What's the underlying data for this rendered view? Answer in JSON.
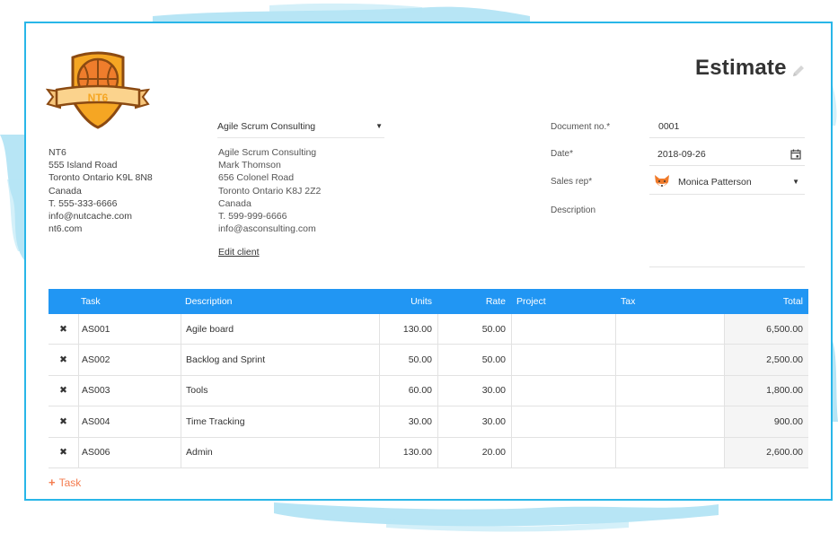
{
  "company": {
    "badge_text": "NT6",
    "lines": [
      "NT6",
      "555 Island Road",
      "Toronto Ontario K9L 8N8",
      "Canada",
      "T. 555-333-6666",
      "info@nutcache.com",
      "nt6.com"
    ]
  },
  "client": {
    "selected": "Agile Scrum Consulting",
    "lines": [
      "Agile Scrum Consulting",
      "Mark Thomson",
      "656 Colonel Road",
      "Toronto Ontario K8J 2Z2",
      "Canada",
      "T. 599-999-6666",
      "info@asconsulting.com"
    ],
    "edit_label": "Edit client"
  },
  "document": {
    "title": "Estimate",
    "doc_no_label": "Document no.*",
    "doc_no": "0001",
    "date_label": "Date*",
    "date": "2018-09-26",
    "sales_rep_label": "Sales rep*",
    "sales_rep": "Monica Patterson",
    "description_label": "Description",
    "description": ""
  },
  "table": {
    "headers": {
      "task": "Task",
      "description": "Description",
      "units": "Units",
      "rate": "Rate",
      "project": "Project",
      "tax": "Tax",
      "total": "Total"
    },
    "rows": [
      {
        "task": "AS001",
        "description": "Agile board",
        "units": "130.00",
        "rate": "50.00",
        "project": "",
        "tax": "",
        "total": "6,500.00"
      },
      {
        "task": "AS002",
        "description": "Backlog and Sprint",
        "units": "50.00",
        "rate": "50.00",
        "project": "",
        "tax": "",
        "total": "2,500.00"
      },
      {
        "task": "AS003",
        "description": "Tools",
        "units": "60.00",
        "rate": "30.00",
        "project": "",
        "tax": "",
        "total": "1,800.00"
      },
      {
        "task": "AS004",
        "description": "Time Tracking",
        "units": "30.00",
        "rate": "30.00",
        "project": "",
        "tax": "",
        "total": "900.00"
      },
      {
        "task": "AS006",
        "description": "Admin",
        "units": "130.00",
        "rate": "20.00",
        "project": "",
        "tax": "",
        "total": "2,600.00"
      }
    ],
    "delete_icon": "✖",
    "add_label": "Task"
  },
  "colors": {
    "frame": "#29b6e8",
    "header": "#2196f3",
    "delete": "#e53935",
    "add": "#f47c4f",
    "badge_orange": "#f5a623",
    "badge_ribbon": "#fbd38d"
  }
}
